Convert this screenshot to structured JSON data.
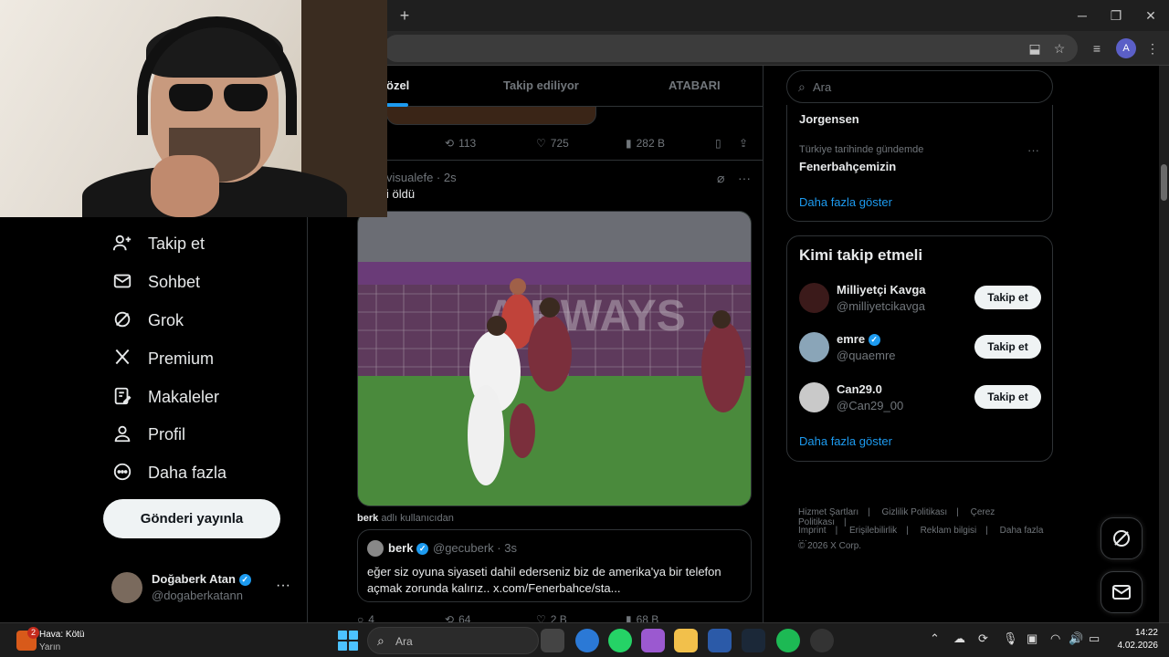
{
  "browser": {
    "new_tab": "+",
    "minimize": "─",
    "restore": "❐",
    "close": "✕",
    "profile_initial": "A"
  },
  "nav": {
    "items": [
      {
        "label": "Takip et",
        "icon": "person-add-icon"
      },
      {
        "label": "Sohbet",
        "icon": "mail-icon"
      },
      {
        "label": "Grok",
        "icon": "grok-icon"
      },
      {
        "label": "Premium",
        "icon": "x-logo-icon"
      },
      {
        "label": "Makaleler",
        "icon": "articles-icon"
      },
      {
        "label": "Profil",
        "icon": "profile-icon"
      },
      {
        "label": "Daha fazla",
        "icon": "more-circle-icon"
      }
    ],
    "post_button": "Gönderi yayınla",
    "user": {
      "name": "Doğaberk Atan",
      "handle": "@dogaberkatann",
      "more": "···"
    }
  },
  "feed": {
    "tabs": [
      "özel",
      "Takip ediliyor",
      "ATABARI"
    ],
    "prev_actions": {
      "retweets": "113",
      "likes": "725",
      "views": "282 B"
    },
    "tweet": {
      "meta": "visualefe · 2s",
      "text": "i öldü",
      "credit_user": "berk",
      "credit_suffix": "adlı kullanıcıdan",
      "quote": {
        "name": "berk",
        "handle": "@gecuberk · 3s",
        "text": "eğer siz oyuna siyaseti dahil ederseniz biz de amerika'ya bir telefon açmak zorunda kalırız.. x.com/Fenerbahce/sta..."
      },
      "actions": {
        "replies": "4",
        "retweets": "64",
        "likes": "2 B",
        "views": "68 B"
      }
    }
  },
  "sidebar": {
    "search_placeholder": "Ara",
    "trends": [
      {
        "title": "Jorgensen",
        "sub": ""
      },
      {
        "title": "Fenerbahçemizin",
        "sub": "Türkiye tarihinde gündemde"
      }
    ],
    "trends_more": "Daha fazla göster",
    "who_title": "Kimi takip etmeli",
    "suggestions": [
      {
        "name": "Milliyetçi Kavga",
        "handle": "@milliyetcikavga",
        "button": "Takip et",
        "verified": false
      },
      {
        "name": "emre",
        "handle": "@quaemre",
        "button": "Takip et",
        "verified": true
      },
      {
        "name": "Can29.0",
        "handle": "@Can29_00",
        "button": "Takip et",
        "verified": false
      }
    ],
    "who_more": "Daha fazla göster",
    "footer": {
      "line1": [
        "Hizmet Şartları",
        "|",
        "Gizlilik Politikası",
        "|",
        "Çerez Politikası",
        "|"
      ],
      "line2": [
        "Imprint",
        "|",
        "Erişilebilirlik",
        "|",
        "Reklam bilgisi",
        "|",
        "Daha fazla ···"
      ],
      "copyright": "© 2026 X Corp."
    }
  },
  "taskbar": {
    "weather_line1": "Hava: Kötü",
    "weather_line2": "Yarın",
    "weather_badge": "2",
    "search": "Ara",
    "time": "14:22",
    "date": "4.02.2026"
  }
}
